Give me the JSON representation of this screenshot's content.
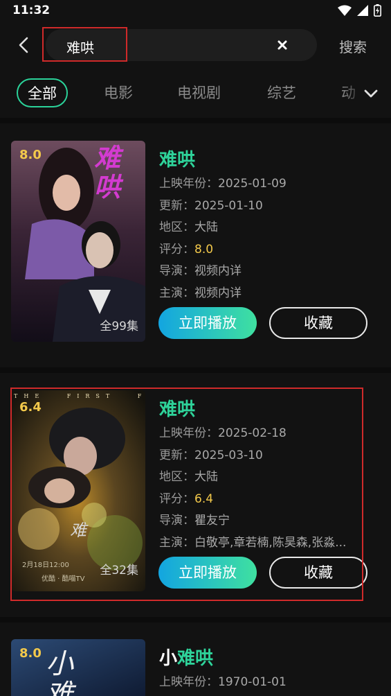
{
  "status_bar": {
    "time": "11:32",
    "icons": [
      "wifi-icon",
      "signal-icon",
      "battery-icon"
    ]
  },
  "search": {
    "value": "难哄",
    "button_label": "搜索"
  },
  "tabs": {
    "items": [
      "全部",
      "电影",
      "电视剧",
      "综艺",
      "动"
    ],
    "active": "全部"
  },
  "results": [
    {
      "title": "难哄",
      "score_badge": "8.0",
      "episodes": "全99集",
      "fields": [
        {
          "label": "上映年份：",
          "value": "2025-01-09"
        },
        {
          "label": "更新：",
          "value": "2025-01-10"
        },
        {
          "label": "地区：",
          "value": "大陆"
        },
        {
          "label": "评分：",
          "value": "8.0"
        },
        {
          "label": "导演：",
          "value": "视频内详"
        },
        {
          "label": "主演：",
          "value": "视频内详"
        }
      ],
      "play_label": "立即播放",
      "fav_label": "收藏",
      "poster_text": "难哄"
    },
    {
      "title": "难哄",
      "score_badge": "6.4",
      "episodes": "全32集",
      "fields": [
        {
          "label": "上映年份：",
          "value": "2025-02-18"
        },
        {
          "label": "更新：",
          "value": "2025-03-10"
        },
        {
          "label": "地区：",
          "value": "大陆"
        },
        {
          "label": "评分：",
          "value": "6.4"
        },
        {
          "label": "导演：",
          "value": "瞿友宁"
        },
        {
          "label": "主演：",
          "value": "白敬亭,章若楠,陈昊森,张淼..."
        }
      ],
      "play_label": "立即播放",
      "fav_label": "收藏",
      "poster_text": "THE FIRST FROST",
      "poster_date": "2月18日12:00",
      "poster_platforms": "优酷 · 酷喵TV"
    },
    {
      "title_prefix": "小",
      "title": "难哄",
      "score_badge": "8.0",
      "fields": [
        {
          "label": "上映年份：",
          "value": "1970-01-01"
        }
      ],
      "poster_text": "小难"
    }
  ],
  "colors": {
    "accent": "#2ed39a",
    "score": "#f3c94b",
    "highlight": "#d02a2a",
    "background": "#121212"
  }
}
